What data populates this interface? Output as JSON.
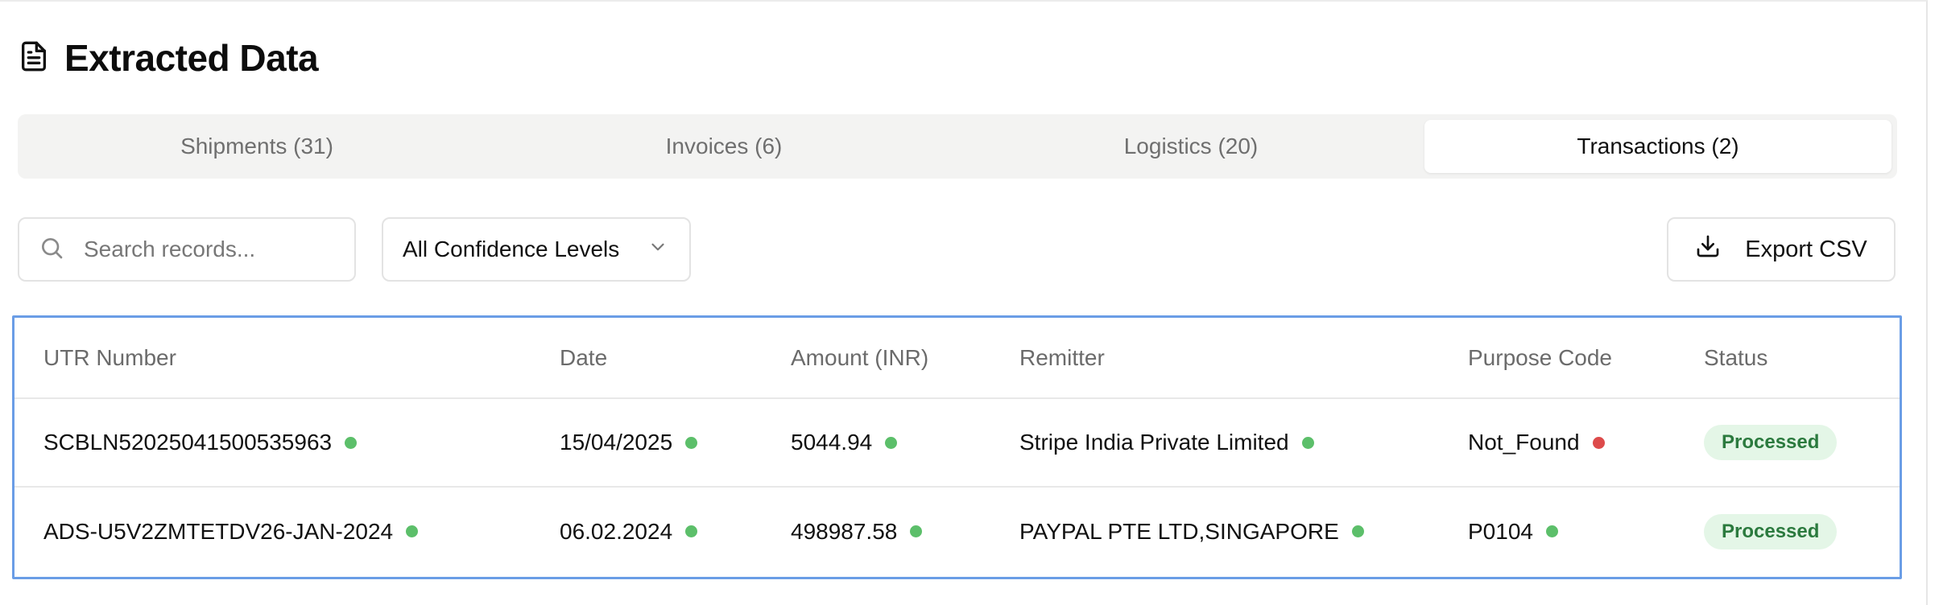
{
  "header": {
    "title": "Extracted Data",
    "icon": "document-icon"
  },
  "tabs": [
    {
      "label": "Shipments (31)",
      "active": false
    },
    {
      "label": "Invoices (6)",
      "active": false
    },
    {
      "label": "Logistics (20)",
      "active": false
    },
    {
      "label": "Transactions (2)",
      "active": true
    }
  ],
  "toolbar": {
    "search_placeholder": "Search records...",
    "search_value": "",
    "confidence_filter": "All Confidence Levels",
    "export_label": "Export CSV"
  },
  "colors": {
    "accent_border": "#6a9de6",
    "confidence_high": "#5cbf6a",
    "confidence_low": "#dd4b4b",
    "status_bg": "#e4f6e7",
    "status_text": "#2b7a3e"
  },
  "table": {
    "columns": [
      "UTR Number",
      "Date",
      "Amount (INR)",
      "Remitter",
      "Purpose Code",
      "Status"
    ],
    "rows": [
      {
        "utr": "SCBLN52025041500535963",
        "utr_conf": "high",
        "date": "15/04/2025",
        "date_conf": "high",
        "amount": "5044.94",
        "amount_conf": "high",
        "remitter": "Stripe India Private Limited",
        "remitter_conf": "high",
        "purpose": "Not_Found",
        "purpose_conf": "low",
        "status": "Processed"
      },
      {
        "utr": "ADS-U5V2ZMTETDV26-JAN-2024",
        "utr_conf": "high",
        "date": "06.02.2024",
        "date_conf": "high",
        "amount": "498987.58",
        "amount_conf": "high",
        "remitter": "PAYPAL PTE LTD,SINGAPORE",
        "remitter_conf": "high",
        "purpose": "P0104",
        "purpose_conf": "high",
        "status": "Processed"
      }
    ]
  }
}
